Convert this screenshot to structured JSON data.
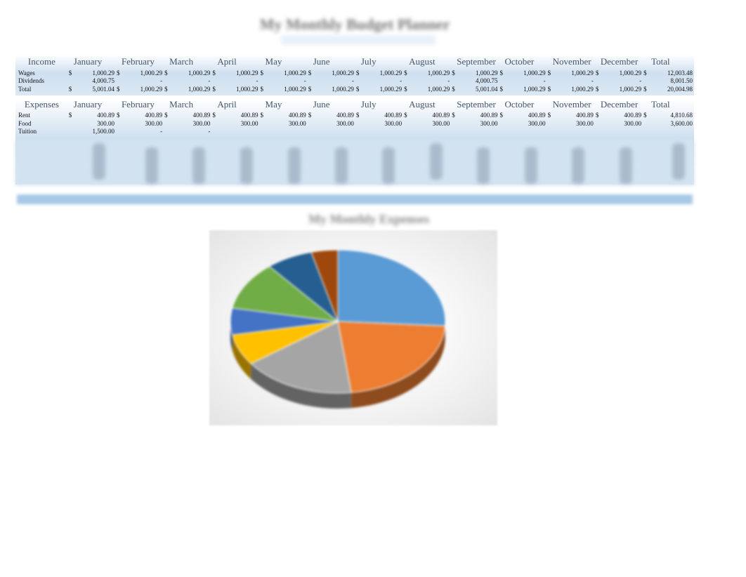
{
  "title": "My Monthly Budget Planner",
  "income": {
    "header": "Income",
    "months": [
      "January",
      "February",
      "March",
      "April",
      "May",
      "June",
      "July",
      "August",
      "September",
      "October",
      "November",
      "December"
    ],
    "total_label": "Total",
    "currency": "$",
    "rows": [
      {
        "label": "Wages",
        "show_currency": true,
        "values": [
          "1,000.29",
          "1,000.29",
          "1,000.29",
          "1,000.29",
          "1,000.29",
          "1,000.29",
          "1,000.29",
          "1,000.29",
          "1,000.29",
          "1,000.29",
          "1,000.29",
          "1,000.29"
        ],
        "total": "12,003.48"
      },
      {
        "label": "Dividends",
        "show_currency": false,
        "values": [
          "4,000.75",
          "-",
          "-",
          "-",
          "-",
          "-",
          "-",
          "-",
          "4,000.75",
          "-",
          "-",
          "-"
        ],
        "total": "8,001.50"
      },
      {
        "label": "Total",
        "show_currency": true,
        "values": [
          "5,001.04",
          "1,000.29",
          "1,000.29",
          "1,000.29",
          "1,000.29",
          "1,000.29",
          "1,000.29",
          "1,000.29",
          "5,001.04",
          "1,000.29",
          "1,000.29",
          "1,000.29"
        ],
        "total": "20,004.98"
      }
    ]
  },
  "expenses": {
    "header": "Expenses",
    "months": [
      "January",
      "February",
      "March",
      "April",
      "May",
      "June",
      "July",
      "August",
      "September",
      "October",
      "November",
      "December"
    ],
    "total_label": "Total",
    "currency": "$",
    "rows": [
      {
        "label": "Rent",
        "show_currency": true,
        "values": [
          "400.89",
          "400.89",
          "400.89",
          "400.89",
          "400.89",
          "400.89",
          "400.89",
          "400.89",
          "400.89",
          "400.89",
          "400.89",
          "400.89"
        ],
        "total": "4,810.68"
      },
      {
        "label": "Food",
        "show_currency": false,
        "values": [
          "300.00",
          "300.00",
          "300.00",
          "300.00",
          "300.00",
          "300.00",
          "300.00",
          "300.00",
          "300.00",
          "300.00",
          "300.00",
          "300.00"
        ],
        "total": "3,600.00"
      },
      {
        "label": "Tuition",
        "show_currency": false,
        "values": [
          "1,500.00",
          "-",
          "-",
          "",
          "",
          "",
          "",
          "",
          "",
          "",
          "",
          ""
        ],
        "total": ""
      }
    ]
  },
  "chart": {
    "title": "My Monthly Expenses",
    "colors": [
      "#5b9bd5",
      "#ed7d31",
      "#a5a5a5",
      "#ffc000",
      "#4472c4",
      "#70ad47",
      "#255e91",
      "#9e480e"
    ]
  },
  "chart_data": {
    "type": "pie",
    "title": "My Monthly Expenses",
    "series": [
      {
        "name": "slice-1",
        "value": 26
      },
      {
        "name": "slice-2",
        "value": 22
      },
      {
        "name": "slice-3",
        "value": 17
      },
      {
        "name": "slice-4",
        "value": 7
      },
      {
        "name": "slice-5",
        "value": 6
      },
      {
        "name": "slice-6",
        "value": 11
      },
      {
        "name": "slice-7",
        "value": 7
      },
      {
        "name": "slice-8",
        "value": 4
      }
    ]
  }
}
